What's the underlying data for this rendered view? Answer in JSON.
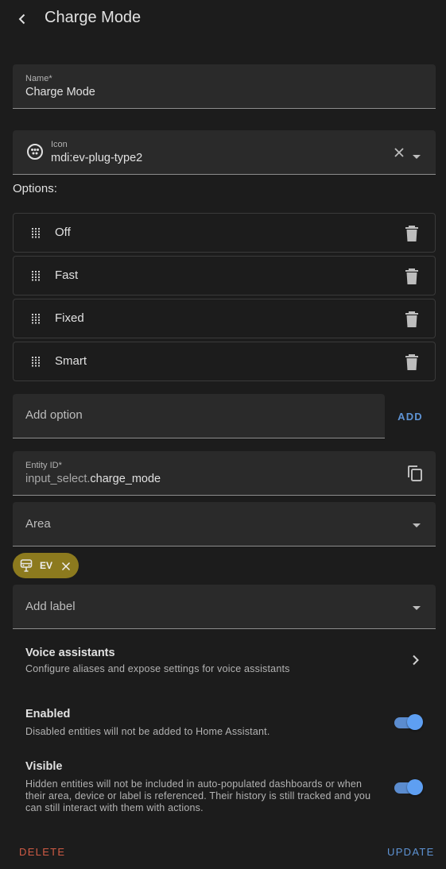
{
  "header": {
    "title": "Charge Mode"
  },
  "name_field": {
    "label": "Name*",
    "value": "Charge Mode"
  },
  "icon_field": {
    "label": "Icon",
    "value": "mdi:ev-plug-type2",
    "icon": "ev-plug-type2-icon"
  },
  "options": {
    "label": "Options:",
    "items": [
      {
        "label": "Off"
      },
      {
        "label": "Fast"
      },
      {
        "label": "Fixed"
      },
      {
        "label": "Smart"
      }
    ],
    "add_placeholder": "Add option",
    "add_button": "ADD"
  },
  "entity_id": {
    "label": "Entity ID*",
    "prefix": "input_select.",
    "value": "charge_mode"
  },
  "area": {
    "placeholder": "Area"
  },
  "area_chip": {
    "label": "EV",
    "icon": "car-icon"
  },
  "labels": {
    "placeholder": "Add label"
  },
  "voice": {
    "title": "Voice assistants",
    "subtitle": "Configure aliases and expose settings for voice assistants"
  },
  "enabled": {
    "title": "Enabled",
    "subtitle": "Disabled entities will not be added to Home Assistant.",
    "on": true
  },
  "visible": {
    "title": "Visible",
    "subtitle": "Hidden entities will not be included in auto-populated dashboards or when their area, device or label is referenced. Their history is still tracked and you can still interact with them with actions.",
    "on": true
  },
  "footer": {
    "delete": "DELETE",
    "update": "UPDATE"
  },
  "colors": {
    "accent": "#5e93d4",
    "danger": "#d05b45",
    "chip": "#8c7a1e",
    "background": "#1c1c1c",
    "field": "#2a2a2a"
  }
}
